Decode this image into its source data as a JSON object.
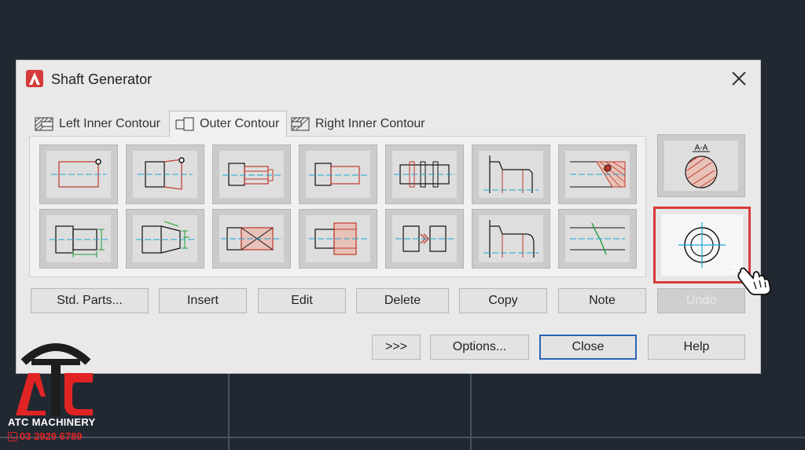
{
  "dialog": {
    "title": "Shaft Generator",
    "icons": {
      "app": "autocad-a-icon",
      "close": "close-icon"
    }
  },
  "tabs": [
    {
      "label": "Left Inner Contour",
      "icon": "left-inner-contour-icon",
      "active": false
    },
    {
      "label": "Outer Contour",
      "icon": "outer-contour-icon",
      "active": true
    },
    {
      "label": "Right Inner Contour",
      "icon": "right-inner-contour-icon",
      "active": false
    }
  ],
  "tools_row1": [
    "cylinder",
    "cone",
    "polygon",
    "thread",
    "grooves",
    "shaft-end",
    "section-line"
  ],
  "tools_row2": [
    "cylinder-dimensioned",
    "cone-dimensioned",
    "polygon-cross",
    "hub-bore",
    "shaft-break",
    "rounded-shoulder",
    "break-line"
  ],
  "side_tools": {
    "top": {
      "label": "A-A",
      "name": "section-view-tool"
    },
    "bottom": {
      "name": "side-view-tool",
      "highlighted": true
    }
  },
  "buttons_row1": [
    {
      "label": "Std. Parts...",
      "enabled": true
    },
    {
      "label": "Insert",
      "enabled": true
    },
    {
      "label": "Edit",
      "enabled": true
    },
    {
      "label": "Delete",
      "enabled": true
    },
    {
      "label": "Copy",
      "enabled": true
    },
    {
      "label": "Note",
      "enabled": true
    },
    {
      "label": "Undo",
      "enabled": false
    }
  ],
  "buttons_row2": [
    {
      "label": ">>>"
    },
    {
      "label": "Options..."
    },
    {
      "label": "Close",
      "default": true
    },
    {
      "label": "Help"
    }
  ],
  "watermark": {
    "logo_text": "ATC",
    "name": "ATC MACHINERY",
    "phone": "03 2929 6789",
    "colors": {
      "red": "#e02424",
      "dark": "#1d1d1d"
    }
  },
  "colors": {
    "accent_red": "#d63b3b",
    "default_button_border": "#2a66b8",
    "drawing_red": "#c0392b",
    "drawing_cyan": "#1aa7d6",
    "drawing_green": "#1f9d3a"
  }
}
